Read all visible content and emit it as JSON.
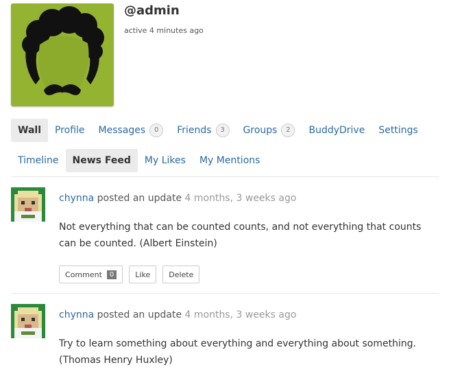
{
  "profile": {
    "username": "@admin",
    "activity": "active 4 minutes ago",
    "avatar_icon": "mustache-man-avatar",
    "avatar_bg": "#8cab2c"
  },
  "nav": {
    "primary": [
      {
        "label": "Wall",
        "active": true
      },
      {
        "label": "Profile"
      },
      {
        "label": "Messages",
        "count": "0"
      },
      {
        "label": "Friends",
        "count": "3"
      },
      {
        "label": "Groups",
        "count": "2"
      },
      {
        "label": "BuddyDrive"
      },
      {
        "label": "Settings"
      }
    ],
    "sub": [
      {
        "label": "Timeline"
      },
      {
        "label": "News Feed",
        "active": true
      },
      {
        "label": "My Likes"
      },
      {
        "label": "My Mentions"
      }
    ]
  },
  "activity": [
    {
      "user": "chynna",
      "action": " posted an update ",
      "time": "4 months, 3 weeks ago",
      "content": "Not everything that can be counted counts, and not everything that counts can be counted. (Albert Einstein)",
      "comment_label": "Comment",
      "comment_count": "0",
      "like_label": "Like",
      "delete_label": "Delete"
    },
    {
      "user": "chynna",
      "action": " posted an update ",
      "time": "4 months, 3 weeks ago",
      "content": "Try to learn something about everything and everything about something. (Thomas Henry Huxley)"
    }
  ],
  "colors": {
    "link": "#2b6aa1",
    "active_tab_bg": "#ebebeb"
  }
}
